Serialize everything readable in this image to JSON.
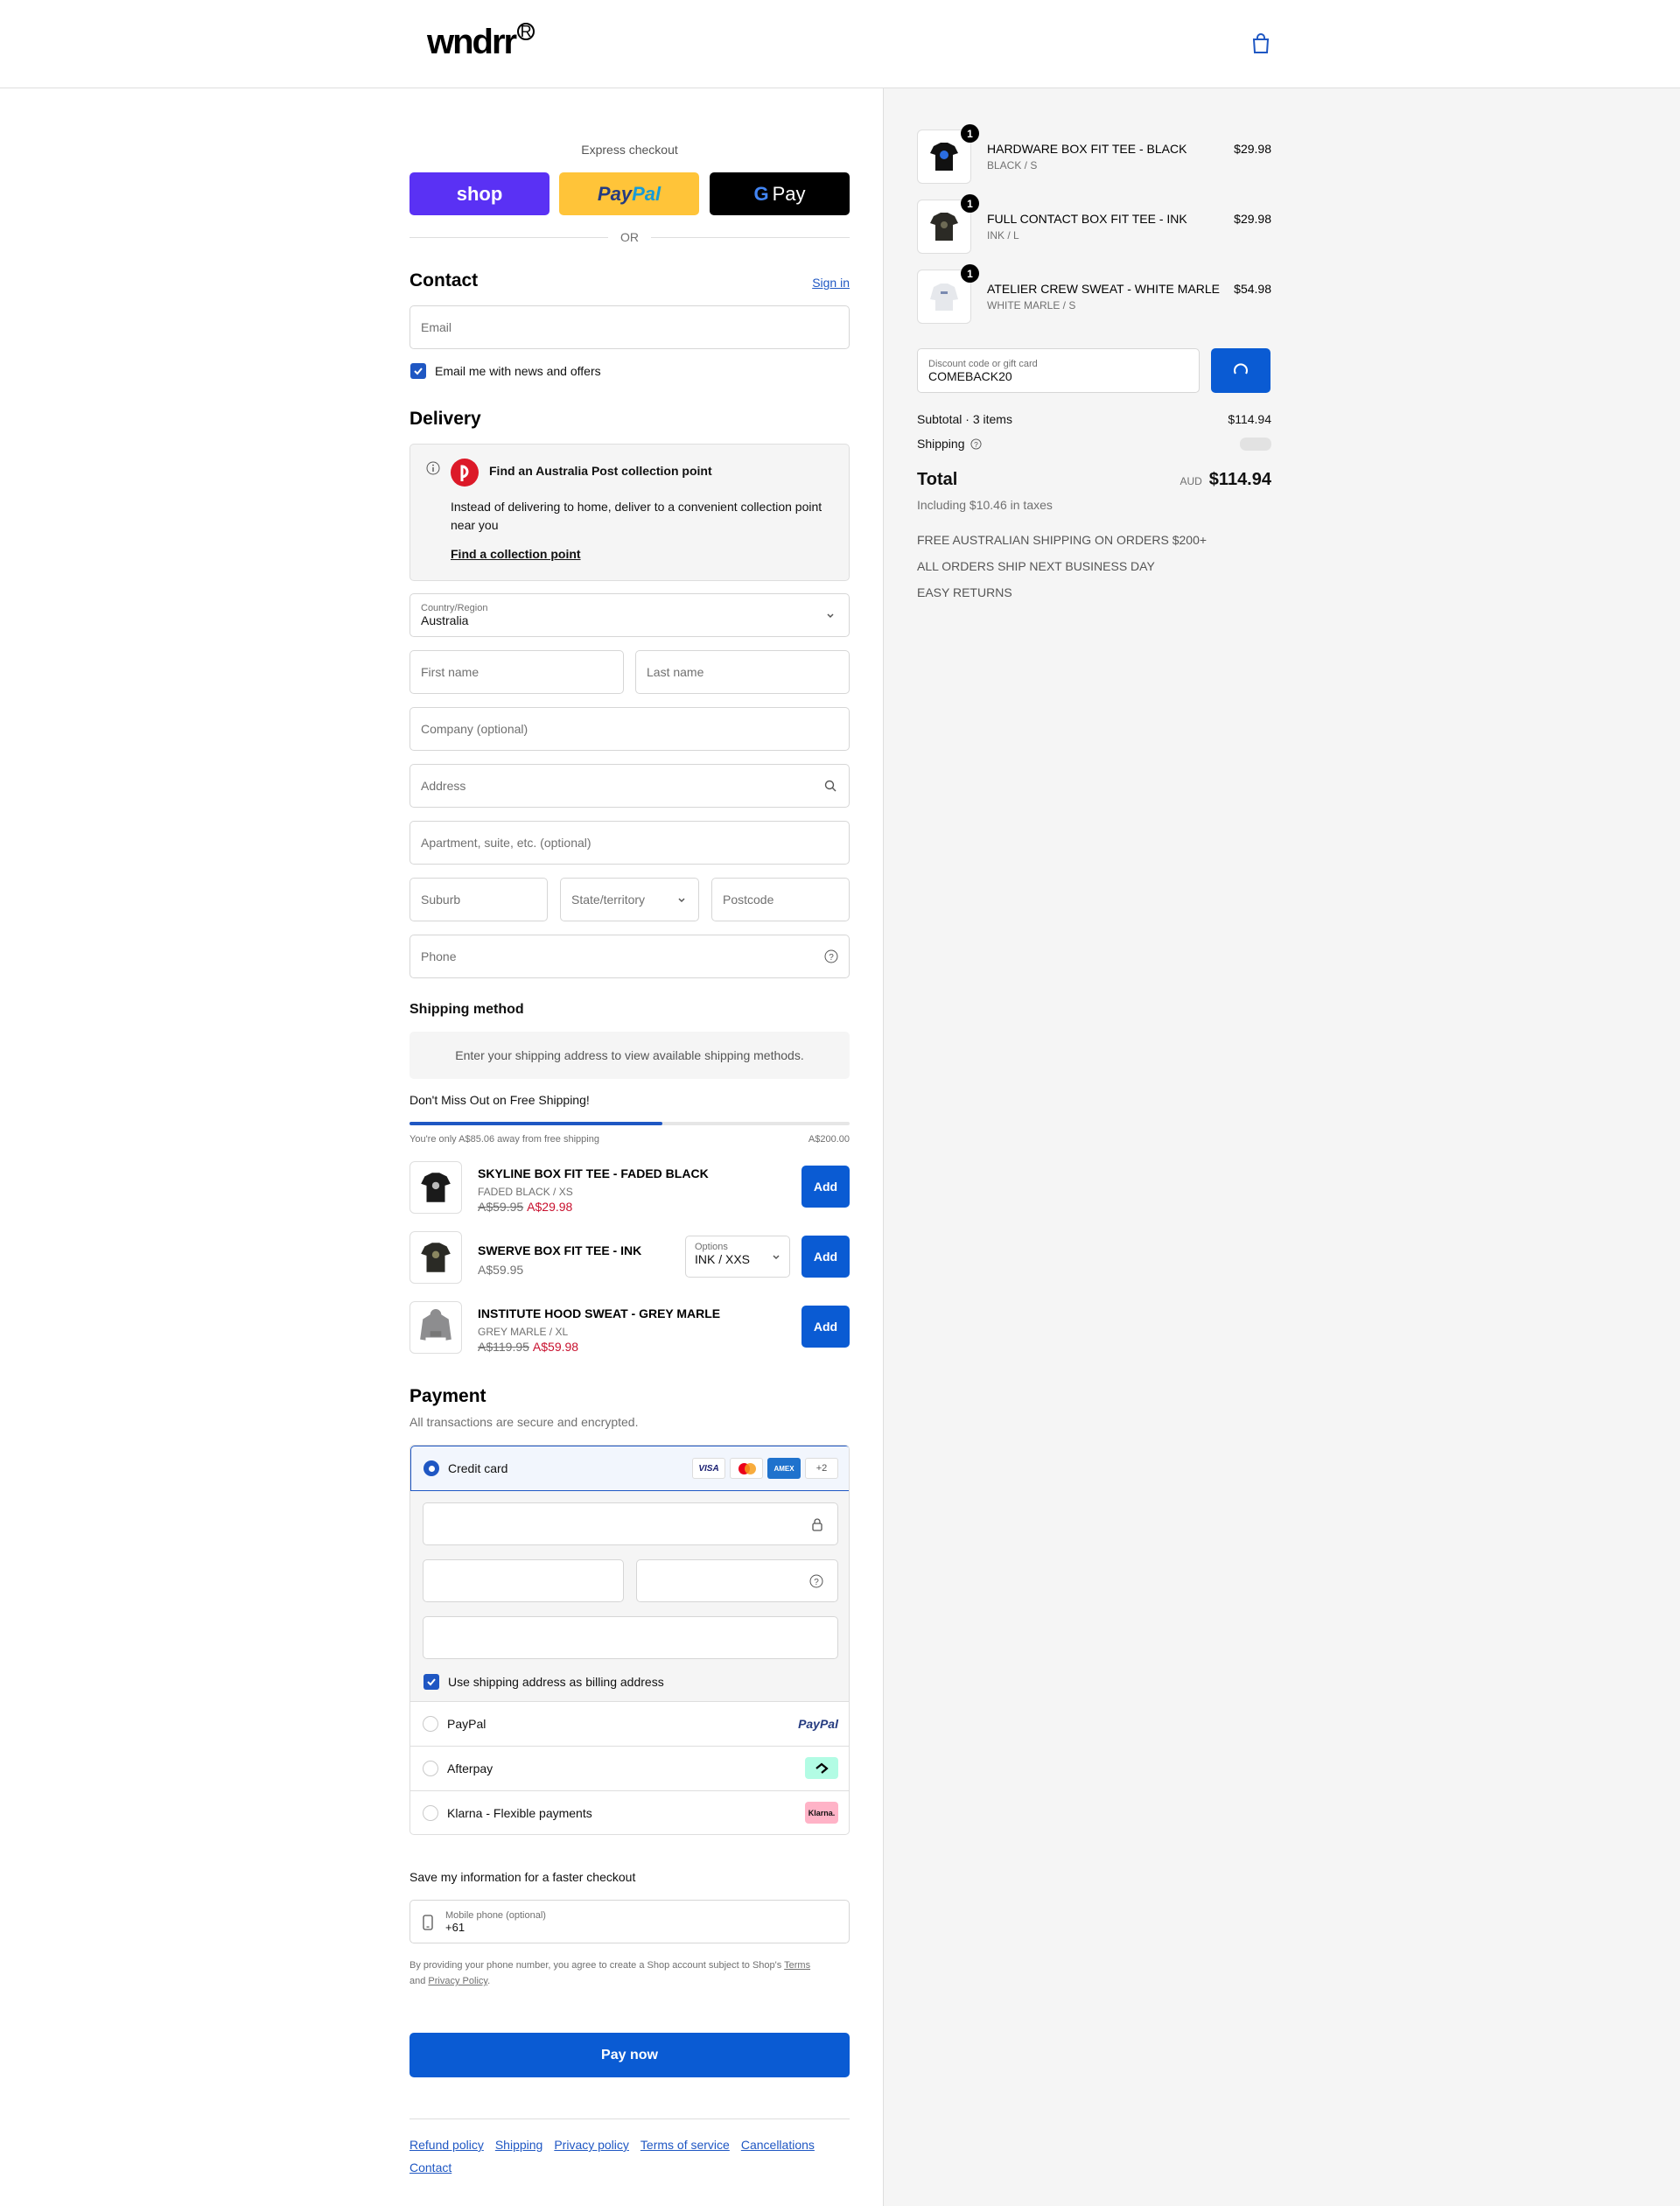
{
  "header": {
    "logo": "wndrr",
    "logo_mark": "R"
  },
  "express": {
    "label": "Express checkout",
    "shop": "shop",
    "paypal_pay": "Pay",
    "paypal_pal": "Pal",
    "gpay": "Pay",
    "or": "OR"
  },
  "contact": {
    "title": "Contact",
    "sign_in": "Sign in",
    "email_placeholder": "Email",
    "newsletter": "Email me with news and offers"
  },
  "delivery": {
    "title": "Delivery",
    "ap_title": "Find an Australia Post collection point",
    "ap_desc": "Instead of delivering to home, deliver to a convenient collection point near you",
    "ap_link": "Find a collection point",
    "country_label": "Country/Region",
    "country_value": "Australia",
    "first_name": "First name",
    "last_name": "Last name",
    "company": "Company (optional)",
    "address": "Address",
    "apartment": "Apartment, suite, etc. (optional)",
    "suburb": "Suburb",
    "state": "State/territory",
    "postcode": "Postcode",
    "phone": "Phone"
  },
  "shipping": {
    "title": "Shipping method",
    "notice": "Enter your shipping address to view available shipping methods."
  },
  "free_shipping": {
    "title": "Don't Miss Out on Free Shipping!",
    "progress_text": "You're only A$85.06 away from free shipping",
    "goal": "A$200.00",
    "progress_fraction": 0.575
  },
  "upsells": [
    {
      "name": "SKYLINE BOX FIT TEE - FADED BLACK",
      "variant": "FADED BLACK / XS",
      "old_price": "A$59.95",
      "price": "A$29.98",
      "add": "Add"
    },
    {
      "name": "SWERVE BOX FIT TEE - INK",
      "price": "A$59.95",
      "options_label": "Options",
      "options_value": "INK / XXS",
      "add": "Add"
    },
    {
      "name": "INSTITUTE HOOD SWEAT - GREY MARLE",
      "variant": "GREY MARLE / XL",
      "old_price": "A$119.95",
      "price": "A$59.98",
      "add": "Add"
    }
  ],
  "payment": {
    "title": "Payment",
    "subtitle": "All transactions are secure and encrypted.",
    "credit_card": "Credit card",
    "card_visa": "VISA",
    "card_amex": "AMEX",
    "card_more": "+2",
    "billing_same": "Use shipping address as billing address",
    "paypal": "PayPal",
    "paypal_logo": "PayPal",
    "afterpay": "Afterpay",
    "klarna": "Klarna - Flexible payments",
    "klarna_logo": "Klarna."
  },
  "save_info": {
    "title": "Save my information for a faster checkout",
    "mobile_label": "Mobile phone (optional)",
    "mobile_value": "+61",
    "terms_pre": "By providing your phone number, you agree to create a Shop account subject to Shop's",
    "terms_link": "Terms",
    "terms_and": "and",
    "privacy_link": "Privacy Policy",
    "terms_end": "."
  },
  "pay_now": "Pay now",
  "footer": {
    "links": [
      "Refund policy",
      "Shipping",
      "Privacy policy",
      "Terms of service",
      "Cancellations",
      "Contact"
    ]
  },
  "summary": {
    "items": [
      {
        "qty": "1",
        "name": "HARDWARE BOX FIT TEE - BLACK",
        "variant": "BLACK / S",
        "price": "$29.98"
      },
      {
        "qty": "1",
        "name": "FULL CONTACT BOX FIT TEE - INK",
        "variant": "INK / L",
        "price": "$29.98"
      },
      {
        "qty": "1",
        "name": "ATELIER CREW SWEAT - WHITE MARLE",
        "variant": "WHITE MARLE / S",
        "price": "$54.98"
      }
    ],
    "discount_label": "Discount code or gift card",
    "discount_value": "COMEBACK20",
    "subtotal_label": "Subtotal · 3 items",
    "subtotal": "$114.94",
    "shipping_label": "Shipping",
    "total_label": "Total",
    "currency": "AUD",
    "total": "$114.94",
    "taxes": "Including $10.46 in taxes",
    "promos": [
      "FREE AUSTRALIAN SHIPPING ON ORDERS $200+",
      "ALL ORDERS SHIP NEXT BUSINESS DAY",
      "EASY RETURNS"
    ]
  },
  "colors": {
    "accent": "#0a5bd3",
    "link": "#1f57c3",
    "sale": "#c8102e",
    "shop": "#5a31f4",
    "paypal": "#ffc439"
  }
}
